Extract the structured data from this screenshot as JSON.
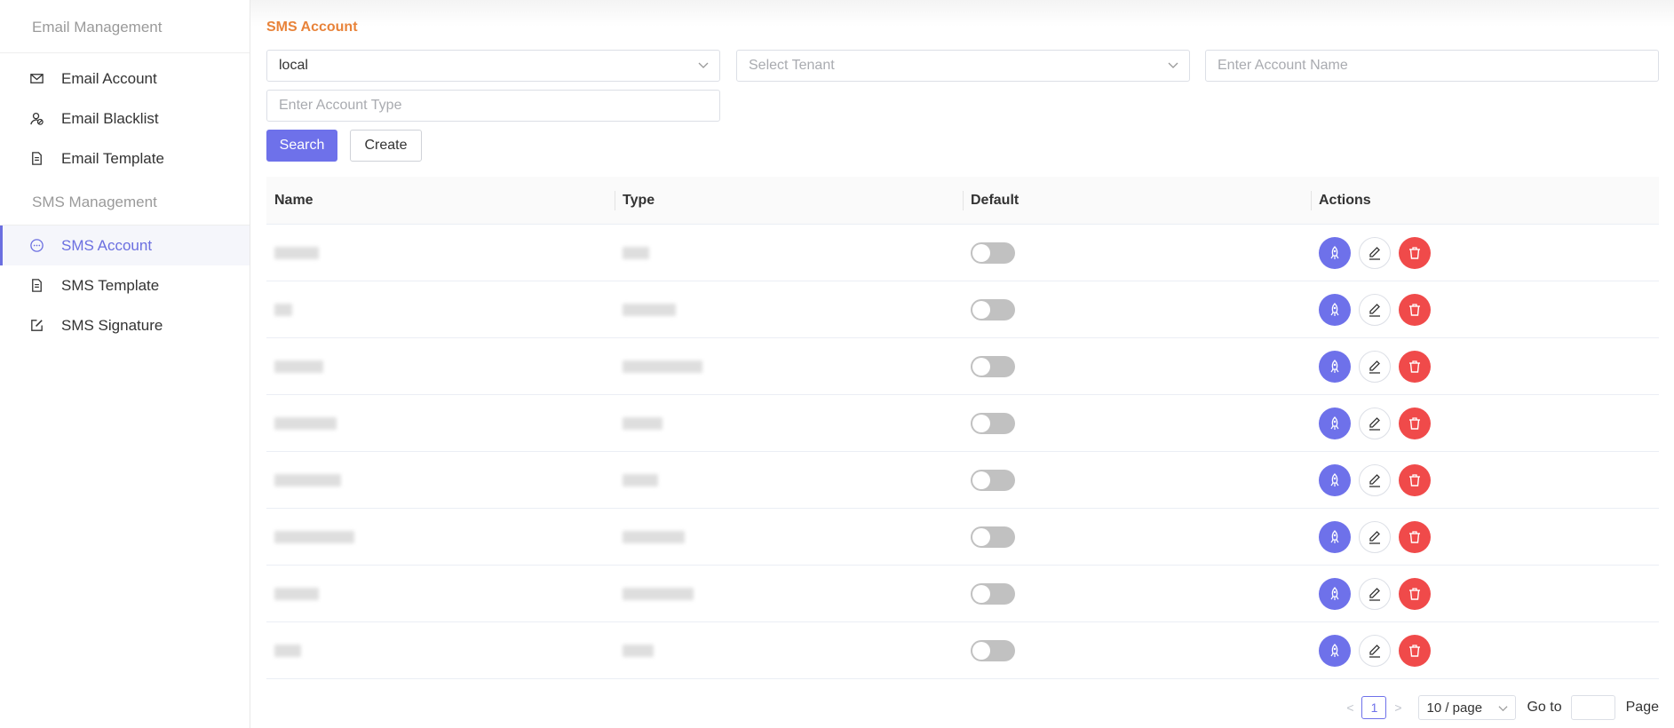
{
  "sidebar": {
    "email_group": "Email Management",
    "email_items": [
      {
        "label": "Email Account",
        "icon": "mail-icon"
      },
      {
        "label": "Email Blacklist",
        "icon": "user-block-icon"
      },
      {
        "label": "Email Template",
        "icon": "document-icon"
      }
    ],
    "sms_group": "SMS Management",
    "sms_items": [
      {
        "label": "SMS Account",
        "icon": "chat-icon",
        "active": true
      },
      {
        "label": "SMS Template",
        "icon": "document-icon"
      },
      {
        "label": "SMS Signature",
        "icon": "edit-square-icon"
      }
    ]
  },
  "page": {
    "title": "SMS Account"
  },
  "filters": {
    "platform_value": "local",
    "tenant_placeholder": "Select Tenant",
    "account_name_placeholder": "Enter Account Name",
    "account_type_placeholder": "Enter Account Type",
    "search_label": "Search",
    "create_label": "Create"
  },
  "table": {
    "headers": {
      "name": "Name",
      "type": "Type",
      "default": "Default",
      "actions": "Actions"
    },
    "rows_count_note": "8 rows with obscured name/type values",
    "default_states": [
      false,
      false,
      false,
      false,
      false,
      false,
      false,
      false
    ]
  },
  "pagination": {
    "current_page": "1",
    "page_size": "10 / page",
    "goto_label": "Go to",
    "page_label": "Page",
    "prev_arrow": "<",
    "next_arrow": ">"
  },
  "colors": {
    "accent": "#6e71ea",
    "title": "#e8833a",
    "danger": "#f04a4a"
  }
}
